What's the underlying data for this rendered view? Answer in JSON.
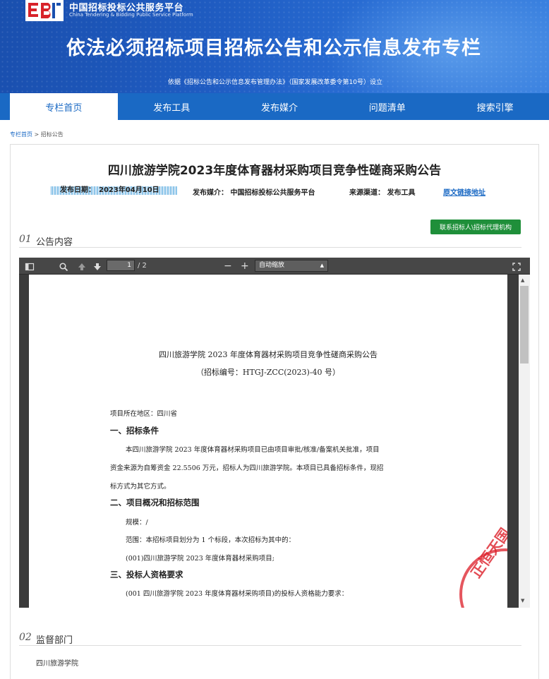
{
  "header": {
    "org_name_cn": "中国招标投标公共服务平台",
    "org_name_en": "China Tendering & Bidding Public Service Platform",
    "banner_title": "依法必须招标项目招标公告和公示信息发布专栏",
    "banner_subtitle": "依据《招标公告和公示信息发布管理办法》（国家发展改革委令第10号）设立"
  },
  "nav": {
    "items": [
      {
        "label": "专栏首页",
        "active": true
      },
      {
        "label": "发布工具"
      },
      {
        "label": "发布媒介"
      },
      {
        "label": "问题清单"
      },
      {
        "label": "搜索引擎"
      }
    ]
  },
  "breadcrumb": {
    "home": "专栏首页",
    "sep": ">",
    "current": "招标公告"
  },
  "notice": {
    "title": "四川旅游学院2023年度体育器材采购项目竞争性磋商采购公告",
    "date": "发布日期：　2023年04月10日",
    "media": "发布媒介：  中国招标投标公共服务平台",
    "source": "来源渠道：  发布工具",
    "source_link": "原文链接地址",
    "contact_button": "联系招标人\\招标代理机构"
  },
  "section1": {
    "num": "01",
    "label": "公告内容"
  },
  "viewer": {
    "page_current": "1",
    "page_total": "/ 2",
    "zoom_label": "自动缩放",
    "doc_title": "四川旅游学院 2023 年度体育器材采购项目竞争性磋商采购公告",
    "doc_code": "（招标编号：HTGJ-ZCC(2023)-40 号）",
    "region": "项目所在地区：四川省",
    "h1": "一、招标条件",
    "p1_l1": "本四川旅游学院 2023 年度体育器材采购项目已由项目审批/核准/备案机关批准，项目",
    "p1_l2": "资金来源为自筹资金 22.5506 万元，招标人为四川旅游学院。本项目已具备招标条件，现招",
    "p1_l3": "标方式为其它方式。",
    "h2": "二、项目概况和招标范围",
    "p2_l1": "规模：/",
    "p2_l2": "范围：本招标项目划分为 1 个标段，本次招标为其中的：",
    "p2_l3": "(001)四川旅游学院 2023 年度体育器材采购项目;",
    "h3": "三、投标人资格要求",
    "p3_l1": "(001 四川旅游学院 2023 年度体育器材采购项目)的投标人资格能力要求：",
    "seal_text": "正恒天国"
  },
  "section2": {
    "num": "02",
    "label": "监督部门"
  },
  "supervisor": {
    "name": "四川旅游学院"
  },
  "colors": {
    "brand": "#1a69c4",
    "button_green": "#1f8f3a",
    "seal_red": "#dc1e28"
  }
}
